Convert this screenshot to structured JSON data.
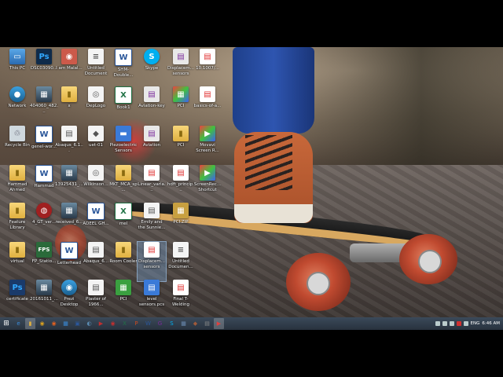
{
  "desktop": {
    "icons": [
      {
        "label": "This PC",
        "glyph": "▭",
        "cls": "g-pc"
      },
      {
        "label": "DSC03090...",
        "glyph": "Ps",
        "cls": "g-ps"
      },
      {
        "label": "I am Malal...",
        "glyph": "◉",
        "cls": "g-photo"
      },
      {
        "label": "Untitled Document",
        "glyph": "≡",
        "cls": "g-doc"
      },
      {
        "label": "SHM-Double...",
        "glyph": "W",
        "cls": "g-word"
      },
      {
        "label": "Skype",
        "glyph": "S",
        "cls": "g-skype"
      },
      {
        "label": "Displacem... sensors",
        "glyph": "▤",
        "cls": "g-app"
      },
      {
        "label": "10.1007/...",
        "glyph": "▤",
        "cls": "g-pdf"
      },
      {
        "label": "Network",
        "glyph": "●",
        "cls": "g-net"
      },
      {
        "label": "404060_482...",
        "glyph": "▦",
        "cls": "g-img"
      },
      {
        "label": "x",
        "glyph": "▮",
        "cls": "g-folder"
      },
      {
        "label": "DepLogo",
        "glyph": "◎",
        "cls": "g-doc"
      },
      {
        "label": "Book1",
        "glyph": "X",
        "cls": "g-excel"
      },
      {
        "label": "Aviation-key",
        "glyph": "▤",
        "cls": "g-app"
      },
      {
        "label": "PCI",
        "glyph": "▦",
        "cls": "g-movavi"
      },
      {
        "label": "basics-of-a...",
        "glyph": "▤",
        "cls": "g-pdf"
      },
      {
        "label": "Recycle Bin",
        "glyph": "♲",
        "cls": "g-bin"
      },
      {
        "label": "genel-wor...",
        "glyph": "W",
        "cls": "g-word"
      },
      {
        "label": "Abaqus_6.1...",
        "glyph": "▤",
        "cls": "g-doc"
      },
      {
        "label": "uet-01",
        "glyph": "◆",
        "cls": "g-doc"
      },
      {
        "label": "Piezoelectric Sensors",
        "glyph": "▬",
        "cls": "g-blue"
      },
      {
        "label": "Aviation",
        "glyph": "▤",
        "cls": "g-app"
      },
      {
        "label": "PCI",
        "glyph": "▮",
        "cls": "g-folder"
      },
      {
        "label": "Movavi Screen R...",
        "glyph": "▶",
        "cls": "g-movavi"
      },
      {
        "label": "Hammad Ahmed",
        "glyph": "▮",
        "cls": "g-folder"
      },
      {
        "label": "Hammad",
        "glyph": "W",
        "cls": "g-word"
      },
      {
        "label": "13925431_...",
        "glyph": "▦",
        "cls": "g-img"
      },
      {
        "label": "Wilkinson...",
        "glyph": "◎",
        "cls": "g-doc"
      },
      {
        "label": "MKT_MCA_sp...",
        "glyph": "▮",
        "cls": "g-folder"
      },
      {
        "label": "Linear_varia...",
        "glyph": "▤",
        "cls": "g-pdf"
      },
      {
        "label": "hdft_princip...",
        "glyph": "▤",
        "cls": "g-pdf"
      },
      {
        "label": "ScreenRec... Shortcut",
        "glyph": "▶",
        "cls": "g-movavi"
      },
      {
        "label": "Feature Library",
        "glyph": "▮",
        "cls": "g-folder"
      },
      {
        "label": "4_GT_ver...",
        "glyph": "◍",
        "cls": "g-red"
      },
      {
        "label": "received_6...",
        "glyph": "▦",
        "cls": "g-img"
      },
      {
        "label": "ADEEL GH...",
        "glyph": "W",
        "cls": "g-word"
      },
      {
        "label": "mel",
        "glyph": "X",
        "cls": "g-excel"
      },
      {
        "label": "Emily and the Sunnie...",
        "glyph": "▤",
        "cls": "g-doc"
      },
      {
        "label": "PCI.ZIP",
        "glyph": "▦",
        "cls": "g-zip"
      },
      {
        "label": "",
        "glyph": "",
        "cls": ""
      },
      {
        "label": "virtual",
        "glyph": "▮",
        "cls": "g-folder"
      },
      {
        "label": "FP_Statio...",
        "glyph": "FPS",
        "cls": "g-fps"
      },
      {
        "label": "Letterhead",
        "glyph": "W",
        "cls": "g-word"
      },
      {
        "label": "Abaqus_6...",
        "glyph": "▤",
        "cls": "g-doc"
      },
      {
        "label": "Room Cooler",
        "glyph": "▮",
        "cls": "g-folder"
      },
      {
        "label": "Displacem... sensors",
        "glyph": "▤",
        "cls": "g-pdf"
      },
      {
        "label": "Untitled Documen...",
        "glyph": "≡",
        "cls": "g-doc"
      },
      {
        "label": "",
        "glyph": "",
        "cls": ""
      },
      {
        "label": "certificate",
        "glyph": "Ps",
        "cls": "g-cert"
      },
      {
        "label": "20161011_...",
        "glyph": "▦",
        "cls": "g-img"
      },
      {
        "label": "Prezi Desktop",
        "glyph": "◉",
        "cls": "g-net"
      },
      {
        "label": "Plaster of 1966...",
        "glyph": "▤",
        "cls": "g-doc"
      },
      {
        "label": "PCI",
        "glyph": "▦",
        "cls": "g-green"
      },
      {
        "label": "level sensors.pcs",
        "glyph": "▤",
        "cls": "g-blue"
      },
      {
        "label": "Final T-Welding",
        "glyph": "▤",
        "cls": "g-pdf"
      },
      {
        "label": "",
        "glyph": "",
        "cls": ""
      }
    ],
    "selected_index": 45
  },
  "taskbar": {
    "start_glyph": "⊞",
    "buttons": [
      {
        "name": "ie",
        "glyph": "e",
        "color": "#3a8ad8"
      },
      {
        "name": "file-explorer",
        "glyph": "▮",
        "color": "#e0b040",
        "active": true
      },
      {
        "name": "chrome",
        "glyph": "◉",
        "color": "#d8a020"
      },
      {
        "name": "firefox",
        "glyph": "◉",
        "color": "#e06020"
      },
      {
        "name": "store",
        "glyph": "▦",
        "color": "#3a8ad8"
      },
      {
        "name": "app1",
        "glyph": "▣",
        "color": "#2b579a"
      },
      {
        "name": "photo",
        "glyph": "◐",
        "color": "#5a8ab0"
      },
      {
        "name": "media",
        "glyph": "▶",
        "color": "#c03030"
      },
      {
        "name": "app2",
        "glyph": "◉",
        "color": "#c03030"
      },
      {
        "name": "excel",
        "glyph": "X",
        "color": "#217346"
      },
      {
        "name": "powerpoint",
        "glyph": "P",
        "color": "#c84a20"
      },
      {
        "name": "word",
        "glyph": "W",
        "color": "#2b579a"
      },
      {
        "name": "app3",
        "glyph": "G",
        "color": "#7a2a9a"
      },
      {
        "name": "skype",
        "glyph": "S",
        "color": "#00aff0"
      },
      {
        "name": "app4",
        "glyph": "▦",
        "color": "#6a8ab0"
      },
      {
        "name": "app5",
        "glyph": "◆",
        "color": "#a05a3a"
      },
      {
        "name": "app6",
        "glyph": "▤",
        "color": "#8a8a8a"
      },
      {
        "name": "movavi",
        "glyph": "▶",
        "color": "#e04040",
        "active": true
      }
    ],
    "tray": {
      "language": "ENG",
      "time": "6:46 AM"
    }
  }
}
